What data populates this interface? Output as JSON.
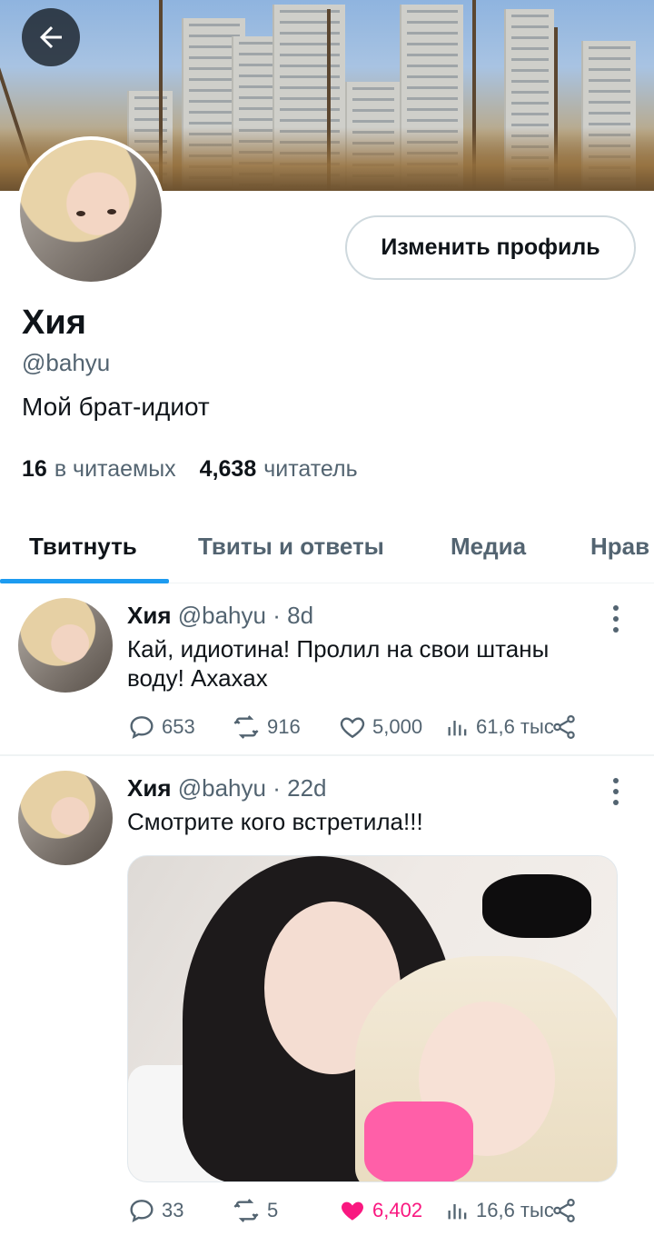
{
  "header": {
    "edit_profile_label": "Изменить профиль"
  },
  "profile": {
    "name": "Хия",
    "handle": "@bahyu",
    "bio": "Мой брат-идиот",
    "following_count": "16",
    "following_label": "в читаемых",
    "followers_count": "4,638",
    "followers_label": "читатель"
  },
  "tabs": [
    {
      "label": "Твитнуть",
      "active": true
    },
    {
      "label": "Твиты и ответы",
      "active": false
    },
    {
      "label": "Медиа",
      "active": false
    },
    {
      "label": "Нрав",
      "active": false
    }
  ],
  "tweets": [
    {
      "name": "Хия",
      "handle": "@bahyu",
      "separator": "·",
      "time": "8d",
      "text": "Кай, идиотина! Пролил на свои штаны воду! Ахахах",
      "replies": "653",
      "retweets": "916",
      "likes": "5,000",
      "views": "61,6 тыс",
      "liked": false
    },
    {
      "name": "Хия",
      "handle": "@bahyu",
      "separator": "·",
      "time": "22d",
      "text": "Смотрите кого встретила!!!",
      "replies": "33",
      "retweets": "5",
      "likes": "6,402",
      "views": "16,6 тыс",
      "liked": true
    }
  ],
  "colors": {
    "accent": "#1d9bf0",
    "like": "#f91880",
    "secondary_text": "#536471"
  }
}
